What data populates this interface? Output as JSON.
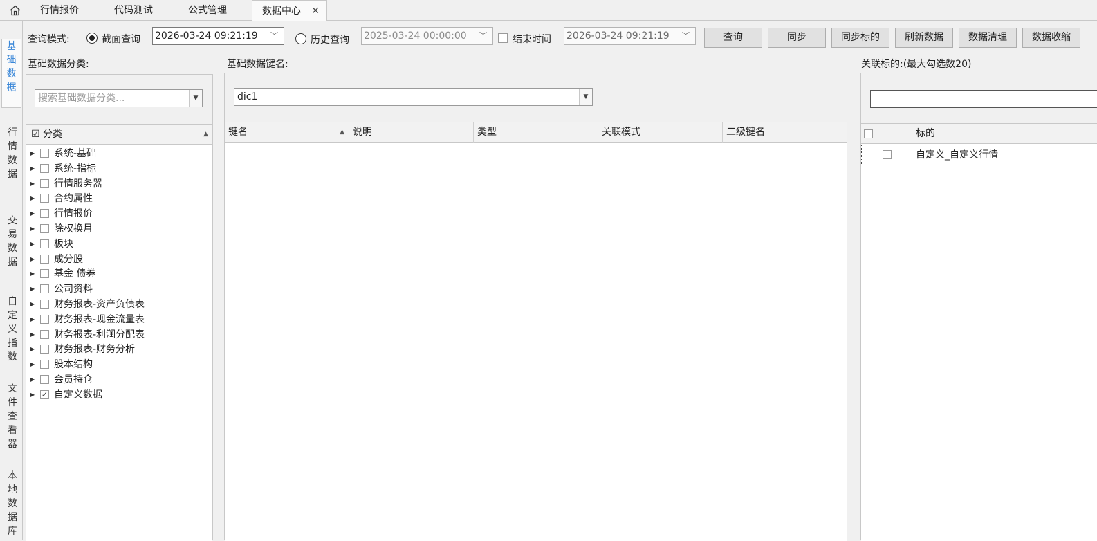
{
  "tabs": {
    "home_icon": "home-icon",
    "items": [
      {
        "label": "行情报价"
      },
      {
        "label": "代码测试"
      },
      {
        "label": "公式管理"
      },
      {
        "label": "数据中心",
        "active": true
      }
    ],
    "close_glyph": "✕"
  },
  "leftnav": [
    {
      "label": "基\n础\n数\n据",
      "active": true
    },
    {
      "label": "行\n情\n数\n据"
    },
    {
      "label": "交\n易\n数\n据"
    },
    {
      "label": "自\n定\n义\n指\n数"
    },
    {
      "label": "文\n件\n查\n看\n器"
    },
    {
      "label": "本\n地\n数\n据\n库"
    }
  ],
  "query": {
    "mode_label": "查询模式:",
    "snapshot_label": "截面查询",
    "snapshot_selected": true,
    "snapshot_datetime": "2026-03-24 09:21:19",
    "history_label": "历史查询",
    "history_datetime": "2025-03-24 00:00:00",
    "end_time_label": "结束时间",
    "end_time_checked": false,
    "end_datetime": "2026-03-24 09:21:19"
  },
  "toolbar": {
    "query": "查询",
    "sync": "同步",
    "sync_targets": "同步标的",
    "refresh": "刷新数据",
    "clean": "数据清理",
    "compact": "数据收缩"
  },
  "category_panel": {
    "title": "基础数据分类:",
    "search_placeholder": "搜索基础数据分类...",
    "header": "分类",
    "header_checked": true,
    "items": [
      {
        "label": "系统-基础",
        "checked": false
      },
      {
        "label": "系统-指标",
        "checked": false
      },
      {
        "label": "行情服务器",
        "checked": false
      },
      {
        "label": "合约属性",
        "checked": false
      },
      {
        "label": "行情报价",
        "checked": false
      },
      {
        "label": "除权换月",
        "checked": false
      },
      {
        "label": "板块",
        "checked": false
      },
      {
        "label": "成分股",
        "checked": false
      },
      {
        "label": "基金 债券",
        "checked": false
      },
      {
        "label": "公司资料",
        "checked": false
      },
      {
        "label": "财务报表-资产负债表",
        "checked": false
      },
      {
        "label": "财务报表-现金流量表",
        "checked": false
      },
      {
        "label": "财务报表-利润分配表",
        "checked": false
      },
      {
        "label": "财务报表-财务分析",
        "checked": false
      },
      {
        "label": "股本结构",
        "checked": false
      },
      {
        "label": "会员持仓",
        "checked": false
      },
      {
        "label": "自定义数据",
        "checked": true
      }
    ]
  },
  "key_panel": {
    "title": "基础数据键名:",
    "selected_key": "dic1",
    "columns": [
      "键名",
      "说明",
      "类型",
      "关联模式",
      "二级键名"
    ]
  },
  "target_panel": {
    "title": "关联标的:(最大勾选数20)",
    "search_value": "",
    "column": "标的",
    "rows": [
      {
        "label": "自定义_自定义行情",
        "checked": false
      }
    ]
  }
}
